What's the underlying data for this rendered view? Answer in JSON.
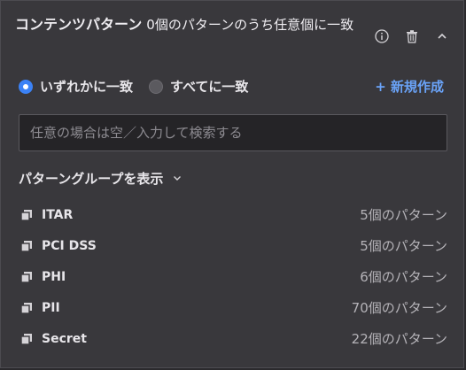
{
  "header": {
    "title_main": "コンテンツパターン",
    "title_sub": "0個のパターンのうち任意個に一致"
  },
  "actions": {
    "info_icon": "info-icon",
    "delete_icon": "trash-icon",
    "collapse_icon": "chevron-up-icon"
  },
  "match_mode": {
    "options": [
      {
        "label": "いずれかに一致",
        "checked": true
      },
      {
        "label": "すべてに一致",
        "checked": false
      }
    ]
  },
  "new_link": "+ 新規作成",
  "search": {
    "placeholder": "任意の場合は空／入力して検索する",
    "value": ""
  },
  "groups_toggle": "パターングループを表示",
  "groups": [
    {
      "name": "ITAR",
      "count": "5個のパターン"
    },
    {
      "name": "PCI DSS",
      "count": "5個のパターン"
    },
    {
      "name": "PHI",
      "count": "6個のパターン"
    },
    {
      "name": "PII",
      "count": "70個のパターン"
    },
    {
      "name": "Secret",
      "count": "22個のパターン"
    }
  ],
  "colors": {
    "accent": "#3b82f6",
    "link": "#6aa3f8",
    "panel": "#39383c"
  }
}
